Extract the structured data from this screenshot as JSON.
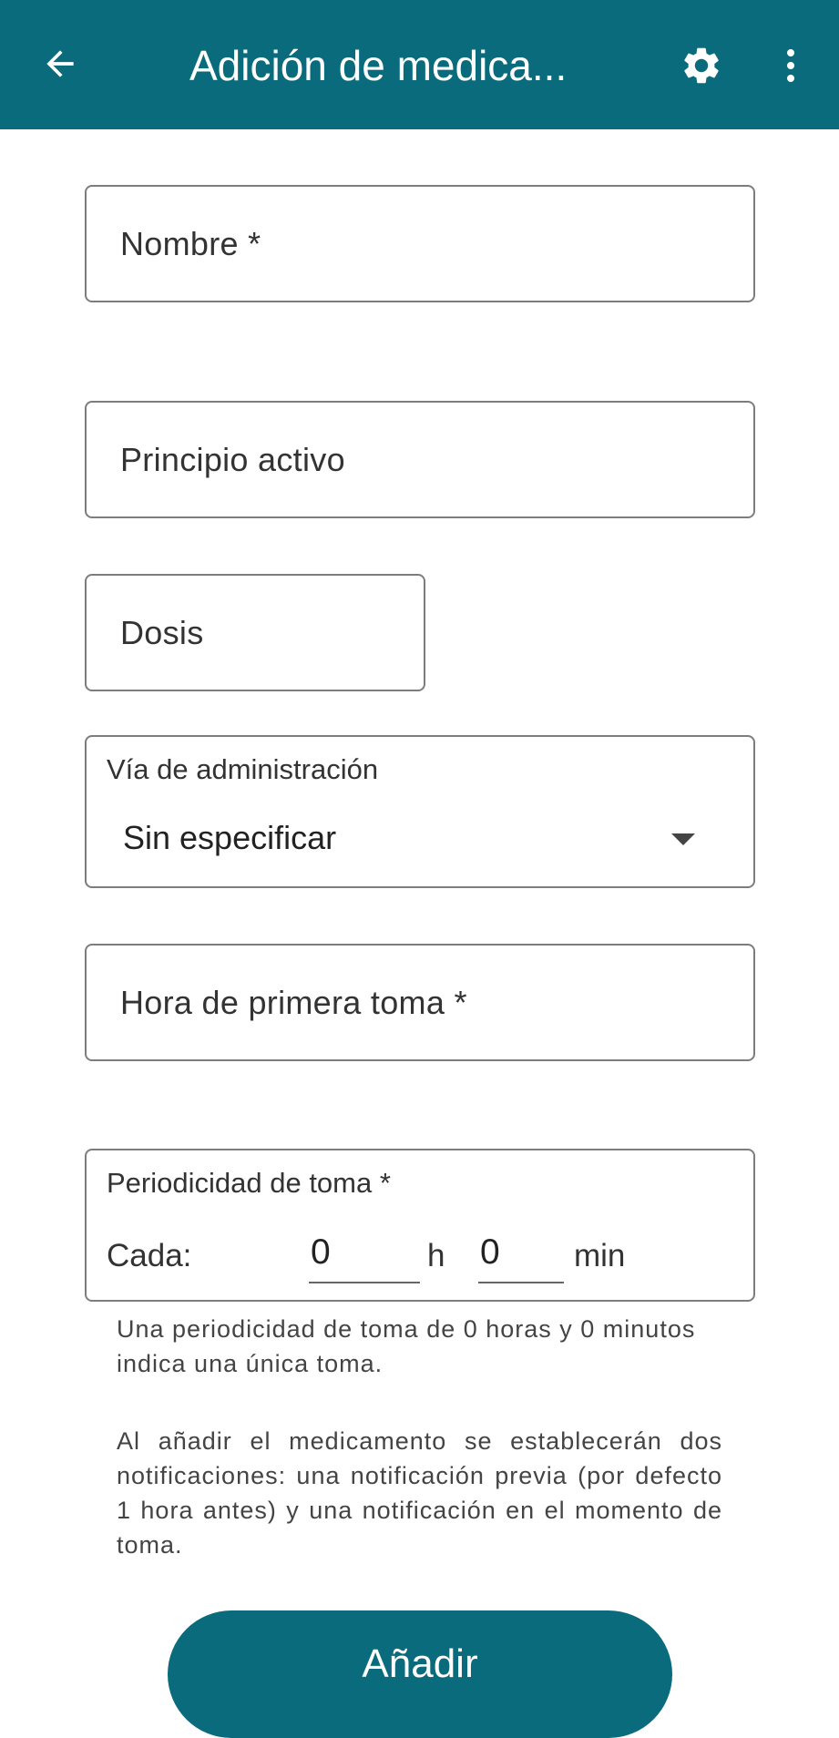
{
  "appbar": {
    "title": "Adición de medica...",
    "back_icon": "arrow-left-icon",
    "settings_icon": "gear-icon",
    "more_icon": "more-vert-icon",
    "color": "#0a6b7c"
  },
  "form": {
    "nombre_placeholder": "Nombre *",
    "principio_placeholder": "Principio activo",
    "dosis_placeholder": "Dosis",
    "via": {
      "label": "Vía de administración",
      "value": "Sin especificar"
    },
    "hora_placeholder": "Hora de primera toma *",
    "periodicidad": {
      "label": "Periodicidad de toma *",
      "cada_label": "Cada:",
      "hours_value": "0",
      "hours_unit": "h",
      "minutes_value": "0",
      "minutes_unit": "min"
    },
    "help_text": "Una periodicidad de toma de 0 horas y 0 minutos indica una única toma.",
    "info_text": "Al añadir el medicamento se establecerán dos notificaciones: una notificación previa (por defecto 1 hora antes) y una notificación en el momento de toma."
  },
  "actions": {
    "add_label": "Añadir"
  }
}
